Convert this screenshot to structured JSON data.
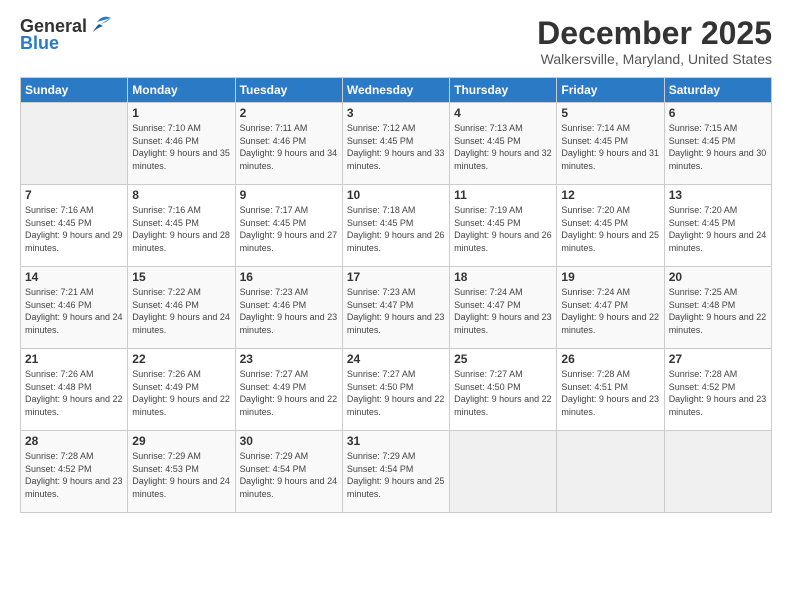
{
  "header": {
    "logo_general": "General",
    "logo_blue": "Blue",
    "month_title": "December 2025",
    "location": "Walkersville, Maryland, United States"
  },
  "days_of_week": [
    "Sunday",
    "Monday",
    "Tuesday",
    "Wednesday",
    "Thursday",
    "Friday",
    "Saturday"
  ],
  "weeks": [
    [
      {
        "day": "",
        "sunrise": "",
        "sunset": "",
        "daylight": ""
      },
      {
        "day": "1",
        "sunrise": "Sunrise: 7:10 AM",
        "sunset": "Sunset: 4:46 PM",
        "daylight": "Daylight: 9 hours and 35 minutes."
      },
      {
        "day": "2",
        "sunrise": "Sunrise: 7:11 AM",
        "sunset": "Sunset: 4:46 PM",
        "daylight": "Daylight: 9 hours and 34 minutes."
      },
      {
        "day": "3",
        "sunrise": "Sunrise: 7:12 AM",
        "sunset": "Sunset: 4:45 PM",
        "daylight": "Daylight: 9 hours and 33 minutes."
      },
      {
        "day": "4",
        "sunrise": "Sunrise: 7:13 AM",
        "sunset": "Sunset: 4:45 PM",
        "daylight": "Daylight: 9 hours and 32 minutes."
      },
      {
        "day": "5",
        "sunrise": "Sunrise: 7:14 AM",
        "sunset": "Sunset: 4:45 PM",
        "daylight": "Daylight: 9 hours and 31 minutes."
      },
      {
        "day": "6",
        "sunrise": "Sunrise: 7:15 AM",
        "sunset": "Sunset: 4:45 PM",
        "daylight": "Daylight: 9 hours and 30 minutes."
      }
    ],
    [
      {
        "day": "7",
        "sunrise": "Sunrise: 7:16 AM",
        "sunset": "Sunset: 4:45 PM",
        "daylight": "Daylight: 9 hours and 29 minutes."
      },
      {
        "day": "8",
        "sunrise": "Sunrise: 7:16 AM",
        "sunset": "Sunset: 4:45 PM",
        "daylight": "Daylight: 9 hours and 28 minutes."
      },
      {
        "day": "9",
        "sunrise": "Sunrise: 7:17 AM",
        "sunset": "Sunset: 4:45 PM",
        "daylight": "Daylight: 9 hours and 27 minutes."
      },
      {
        "day": "10",
        "sunrise": "Sunrise: 7:18 AM",
        "sunset": "Sunset: 4:45 PM",
        "daylight": "Daylight: 9 hours and 26 minutes."
      },
      {
        "day": "11",
        "sunrise": "Sunrise: 7:19 AM",
        "sunset": "Sunset: 4:45 PM",
        "daylight": "Daylight: 9 hours and 26 minutes."
      },
      {
        "day": "12",
        "sunrise": "Sunrise: 7:20 AM",
        "sunset": "Sunset: 4:45 PM",
        "daylight": "Daylight: 9 hours and 25 minutes."
      },
      {
        "day": "13",
        "sunrise": "Sunrise: 7:20 AM",
        "sunset": "Sunset: 4:45 PM",
        "daylight": "Daylight: 9 hours and 24 minutes."
      }
    ],
    [
      {
        "day": "14",
        "sunrise": "Sunrise: 7:21 AM",
        "sunset": "Sunset: 4:46 PM",
        "daylight": "Daylight: 9 hours and 24 minutes."
      },
      {
        "day": "15",
        "sunrise": "Sunrise: 7:22 AM",
        "sunset": "Sunset: 4:46 PM",
        "daylight": "Daylight: 9 hours and 24 minutes."
      },
      {
        "day": "16",
        "sunrise": "Sunrise: 7:23 AM",
        "sunset": "Sunset: 4:46 PM",
        "daylight": "Daylight: 9 hours and 23 minutes."
      },
      {
        "day": "17",
        "sunrise": "Sunrise: 7:23 AM",
        "sunset": "Sunset: 4:47 PM",
        "daylight": "Daylight: 9 hours and 23 minutes."
      },
      {
        "day": "18",
        "sunrise": "Sunrise: 7:24 AM",
        "sunset": "Sunset: 4:47 PM",
        "daylight": "Daylight: 9 hours and 23 minutes."
      },
      {
        "day": "19",
        "sunrise": "Sunrise: 7:24 AM",
        "sunset": "Sunset: 4:47 PM",
        "daylight": "Daylight: 9 hours and 22 minutes."
      },
      {
        "day": "20",
        "sunrise": "Sunrise: 7:25 AM",
        "sunset": "Sunset: 4:48 PM",
        "daylight": "Daylight: 9 hours and 22 minutes."
      }
    ],
    [
      {
        "day": "21",
        "sunrise": "Sunrise: 7:26 AM",
        "sunset": "Sunset: 4:48 PM",
        "daylight": "Daylight: 9 hours and 22 minutes."
      },
      {
        "day": "22",
        "sunrise": "Sunrise: 7:26 AM",
        "sunset": "Sunset: 4:49 PM",
        "daylight": "Daylight: 9 hours and 22 minutes."
      },
      {
        "day": "23",
        "sunrise": "Sunrise: 7:27 AM",
        "sunset": "Sunset: 4:49 PM",
        "daylight": "Daylight: 9 hours and 22 minutes."
      },
      {
        "day": "24",
        "sunrise": "Sunrise: 7:27 AM",
        "sunset": "Sunset: 4:50 PM",
        "daylight": "Daylight: 9 hours and 22 minutes."
      },
      {
        "day": "25",
        "sunrise": "Sunrise: 7:27 AM",
        "sunset": "Sunset: 4:50 PM",
        "daylight": "Daylight: 9 hours and 22 minutes."
      },
      {
        "day": "26",
        "sunrise": "Sunrise: 7:28 AM",
        "sunset": "Sunset: 4:51 PM",
        "daylight": "Daylight: 9 hours and 23 minutes."
      },
      {
        "day": "27",
        "sunrise": "Sunrise: 7:28 AM",
        "sunset": "Sunset: 4:52 PM",
        "daylight": "Daylight: 9 hours and 23 minutes."
      }
    ],
    [
      {
        "day": "28",
        "sunrise": "Sunrise: 7:28 AM",
        "sunset": "Sunset: 4:52 PM",
        "daylight": "Daylight: 9 hours and 23 minutes."
      },
      {
        "day": "29",
        "sunrise": "Sunrise: 7:29 AM",
        "sunset": "Sunset: 4:53 PM",
        "daylight": "Daylight: 9 hours and 24 minutes."
      },
      {
        "day": "30",
        "sunrise": "Sunrise: 7:29 AM",
        "sunset": "Sunset: 4:54 PM",
        "daylight": "Daylight: 9 hours and 24 minutes."
      },
      {
        "day": "31",
        "sunrise": "Sunrise: 7:29 AM",
        "sunset": "Sunset: 4:54 PM",
        "daylight": "Daylight: 9 hours and 25 minutes."
      },
      {
        "day": "",
        "sunrise": "",
        "sunset": "",
        "daylight": ""
      },
      {
        "day": "",
        "sunrise": "",
        "sunset": "",
        "daylight": ""
      },
      {
        "day": "",
        "sunrise": "",
        "sunset": "",
        "daylight": ""
      }
    ]
  ]
}
